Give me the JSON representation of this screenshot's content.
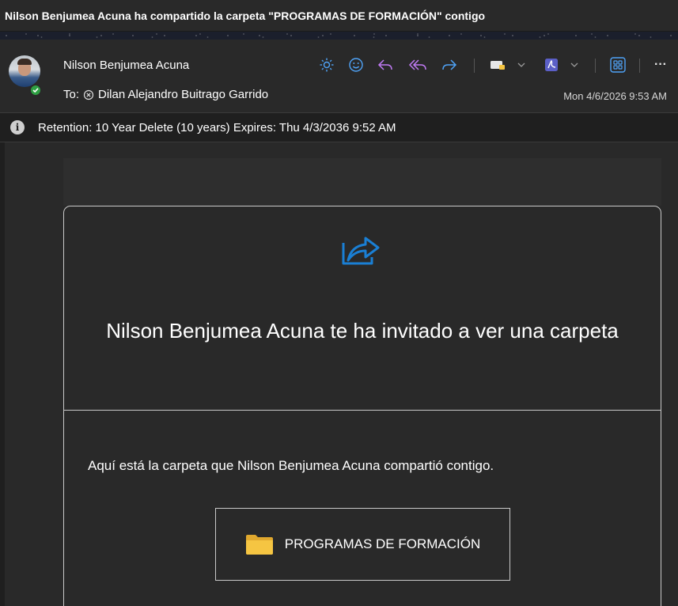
{
  "subject": "Nilson Benjumea Acuna ha compartido la carpeta \"PROGRAMAS DE FORMACIÓN\" contigo",
  "sender": {
    "name": "Nilson Benjumea Acuna",
    "presence_status_color": "#2ea043"
  },
  "recipients": {
    "label": "To:",
    "name": "Dilan Alejandro Buitrago Garrido"
  },
  "datetime": "Mon 4/6/2026 9:53 AM",
  "toolbar": {
    "icons": [
      "sun-icon",
      "smiley-icon",
      "reply-icon",
      "reply-all-icon",
      "forward-icon",
      "tag-icon",
      "chevron-down-icon",
      "pdf-icon",
      "chevron-down-icon",
      "apps-icon",
      "more-icon"
    ],
    "accent_blue": "#4fa3f7",
    "accent_purple": "#c17bf5",
    "more_label": "···"
  },
  "retention": {
    "text": "Retention: 10 Year Delete (10 years) Expires: Thu 4/3/2036 9:52 AM"
  },
  "card": {
    "title": "Nilson Benjumea Acuna te ha invitado a ver una carpeta",
    "message": "Aquí está la carpeta que Nilson Benjumea Acuna compartió contigo.",
    "folder_name": "PROGRAMAS DE FORMACIÓN",
    "share_icon_color": "#1a7fd4",
    "folder_icon_color": "#f5c542"
  }
}
